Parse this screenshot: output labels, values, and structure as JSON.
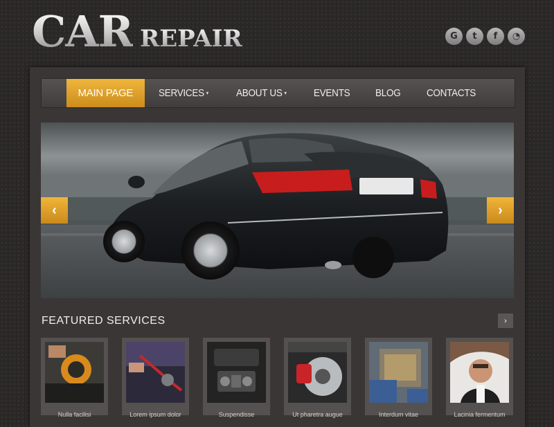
{
  "header": {
    "logo_main": "CAR",
    "logo_sub": "REPAIR",
    "social_icons": [
      {
        "icon": "google-icon",
        "glyph": "G"
      },
      {
        "icon": "twitter-icon",
        "glyph": "t"
      },
      {
        "icon": "facebook-icon",
        "glyph": "f"
      },
      {
        "icon": "rss-icon",
        "glyph": "◔"
      }
    ]
  },
  "nav": {
    "items": [
      {
        "label": "MAIN PAGE",
        "active": true,
        "dropdown": false
      },
      {
        "label": "SERVICES",
        "active": false,
        "dropdown": true
      },
      {
        "label": "ABOUT US",
        "active": false,
        "dropdown": true
      },
      {
        "label": "EVENTS",
        "active": false,
        "dropdown": false
      },
      {
        "label": "BLOG",
        "active": false,
        "dropdown": false
      },
      {
        "label": "CONTACTS",
        "active": false,
        "dropdown": false
      }
    ]
  },
  "slider": {
    "prev_glyph": "‹",
    "next_glyph": "›"
  },
  "featured": {
    "title": "FEATURED SERVICES",
    "more_glyph": "›",
    "items": [
      {
        "caption": "Nulla facilisi"
      },
      {
        "caption": "Lorem ipsum dolor"
      },
      {
        "caption": "Suspendisse"
      },
      {
        "caption": "Ut pharetra augue"
      },
      {
        "caption": "Interdum vitae"
      },
      {
        "caption": "Lacinia fermentum"
      }
    ]
  },
  "colors": {
    "accent": "#e5a72f",
    "background": "#2a2727",
    "panel": "#3a3636"
  }
}
